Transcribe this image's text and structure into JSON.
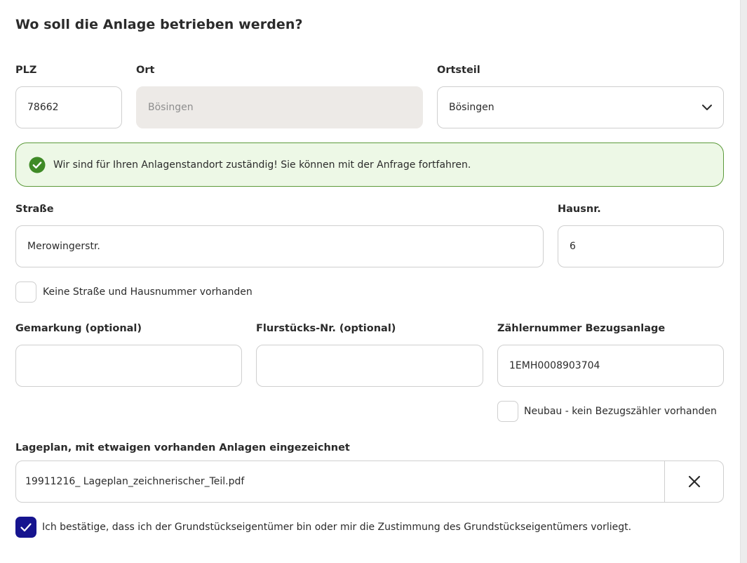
{
  "section_title": "Wo soll die Anlage betrieben werden?",
  "plz": {
    "label": "PLZ",
    "value": "78662"
  },
  "ort": {
    "label": "Ort",
    "value": "Bösingen"
  },
  "ortsteil": {
    "label": "Ortsteil",
    "value": "Bösingen",
    "icon": "chevron-down-icon"
  },
  "alert": {
    "text": "Wir sind für Ihren Anlagenstandort zuständig! Sie können mit der Anfrage fortfahren.",
    "icon": "check-circle-icon",
    "color": "#5c9a3a"
  },
  "strasse": {
    "label": "Straße",
    "value": "Merowingerstr."
  },
  "hausnr": {
    "label": "Hausnr.",
    "value": "6"
  },
  "no_street_checkbox": {
    "label": "Keine Straße und Hausnummer vorhanden",
    "checked": false
  },
  "gemarkung": {
    "label": "Gemarkung (optional)",
    "value": ""
  },
  "flurstueck": {
    "label": "Flurstücks-Nr. (optional)",
    "value": ""
  },
  "zaehlernummer": {
    "label": "Zählernummer Bezugsanlage",
    "value": "1EMH0008903704"
  },
  "neubau_checkbox": {
    "label": "Neubau - kein Bezugszähler vorhanden",
    "checked": false
  },
  "lageplan": {
    "label": "Lageplan, mit etwaigen vorhanden Anlagen eingezeichnet",
    "file_name": "19911216_ Lageplan_zeichnerischer_Teil.pdf",
    "remove_icon": "close-icon"
  },
  "confirm_checkbox": {
    "label": "Ich bestätige, dass ich der Grundstückseigentümer bin oder mir die Zustimmung des Grundstückseigentümers vorliegt.",
    "checked": true,
    "color": "#16148f"
  }
}
